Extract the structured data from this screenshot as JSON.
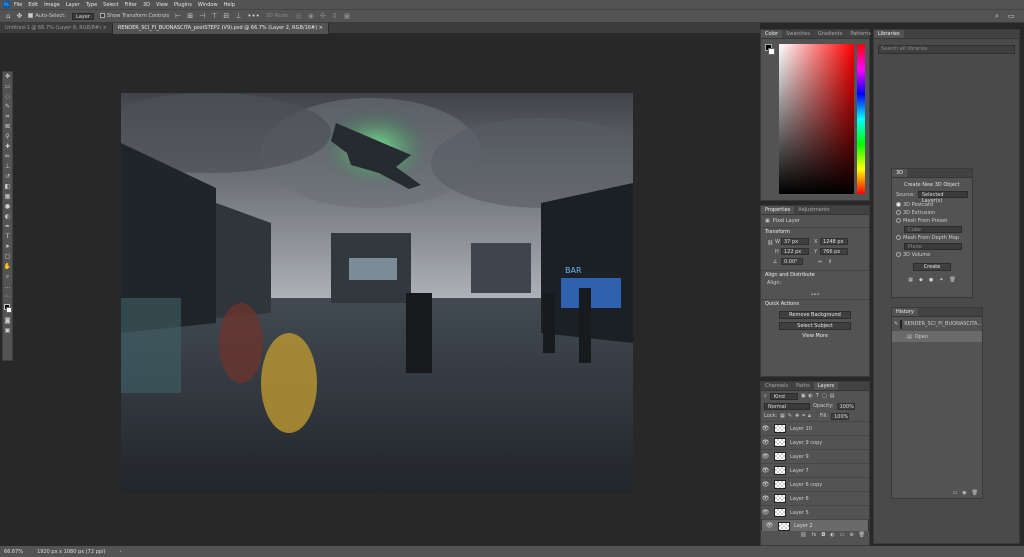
{
  "app": {
    "logo": "Ps"
  },
  "menu": [
    "File",
    "Edit",
    "Image",
    "Layer",
    "Type",
    "Select",
    "Filter",
    "3D",
    "View",
    "Plugins",
    "Window",
    "Help"
  ],
  "options": {
    "auto_select_label": "Auto-Select:",
    "auto_select_value": "Layer",
    "show_transform_label": "Show Transform Controls",
    "mode_3d_label": "3D Mode:"
  },
  "tabs": [
    {
      "label": "Untitled-1 @ 66.7% (Layer 8, RGB/8#)",
      "active": false
    },
    {
      "label": "RENDER_SCI_FI_BUONASCITA_postSTEP2 (V9).psd @ 66.7% (Layer 2, RGB/16#)",
      "active": true
    }
  ],
  "status": {
    "zoom": "66.67%",
    "doc_size": "1920 px x 1080 px (72 ppi)"
  },
  "color_panel": {
    "tabs": [
      "Color",
      "Swatches",
      "Gradients",
      "Patterns"
    ]
  },
  "libraries_panel": {
    "title": "Libraries",
    "search_placeholder": "Search all libraries"
  },
  "panel_3d": {
    "title": "3D",
    "create_label": "Create New 3D Object",
    "source_label": "Source:",
    "source_value": "Selected Layer(s)",
    "options": [
      {
        "label": "3D Postcard",
        "on": true
      },
      {
        "label": "3D Extrusion",
        "on": false
      },
      {
        "label": "Mesh From Preset",
        "on": false
      },
      {
        "label": "Mesh From Depth Map",
        "on": false
      },
      {
        "label": "3D Volume",
        "on": false
      }
    ],
    "preset_value": "Cube",
    "depth_value": "Plane",
    "create_button": "Create"
  },
  "properties_panel": {
    "tabs": [
      "Properties",
      "Adjustments"
    ],
    "layer_kind": "Pixel Layer",
    "transform_title": "Transform",
    "w_label": "W",
    "w_value": "37 px",
    "x_label": "X",
    "x_value": "1248 px",
    "h_label": "H",
    "h_value": "122 px",
    "y_label": "Y",
    "y_value": "766 px",
    "angle_value": "0.00°",
    "align_title": "Align and Distribute",
    "align_sub": "Align:",
    "quick_title": "Quick Actions",
    "remove_bg": "Remove Background",
    "select_subject": "Select Subject",
    "view_more": "View More"
  },
  "history_panel": {
    "title": "History",
    "snapshot_label": "RENDER_SCI_FI_BUONASCITA...",
    "states": [
      "Open"
    ]
  },
  "layers_panel": {
    "tabs": [
      "Channels",
      "Paths",
      "Layers"
    ],
    "filter_kind": "Kind",
    "blend_mode": "Normal",
    "opacity_label": "Opacity:",
    "opacity_value": "100%",
    "lock_label": "Lock:",
    "fill_label": "Fill:",
    "fill_value": "100%",
    "layers": [
      {
        "name": "Layer 10",
        "selected": false
      },
      {
        "name": "Layer 9 copy",
        "selected": false
      },
      {
        "name": "Layer 9",
        "selected": false
      },
      {
        "name": "Layer 7",
        "selected": false
      },
      {
        "name": "Layer 6 copy",
        "selected": false
      },
      {
        "name": "Layer 6",
        "selected": false
      },
      {
        "name": "Layer 5",
        "selected": false
      },
      {
        "name": "Layer 2",
        "selected": true
      }
    ]
  },
  "artwork": {
    "sign_text": "BAR"
  }
}
